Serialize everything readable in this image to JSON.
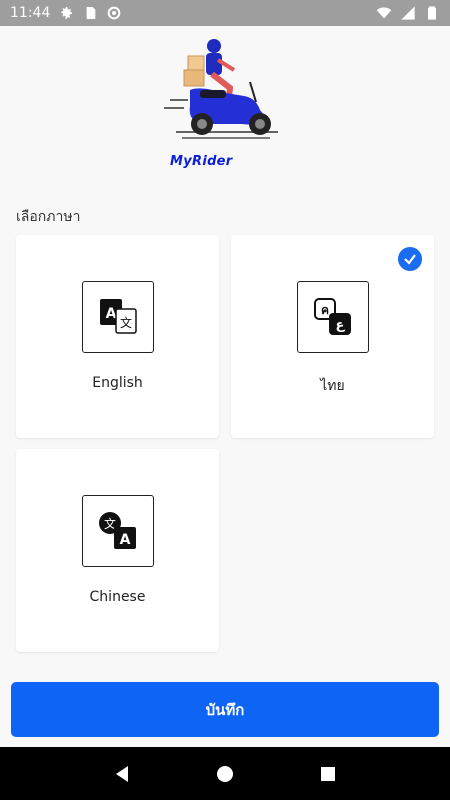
{
  "status_bar": {
    "time": "11:44",
    "icons": [
      "settings-icon",
      "sd-card-icon",
      "sync-icon",
      "wifi-icon",
      "signal-icon",
      "battery-icon"
    ]
  },
  "app": {
    "brand_name": "MyRider"
  },
  "language_section": {
    "label": "เลือกภาษา"
  },
  "languages": [
    {
      "label": "English",
      "icon": "translate-icon",
      "selected": false
    },
    {
      "label": "ไทย",
      "icon": "thai-language-icon",
      "selected": true
    },
    {
      "label": "Chinese",
      "icon": "chinese-language-icon",
      "selected": false
    }
  ],
  "actions": {
    "save_label": "บันทึก"
  },
  "colors": {
    "primary": "#0e64f5",
    "brand_text": "#0a1fd8",
    "status_bar": "#9e9e9e",
    "check": "#1a6cf0"
  }
}
